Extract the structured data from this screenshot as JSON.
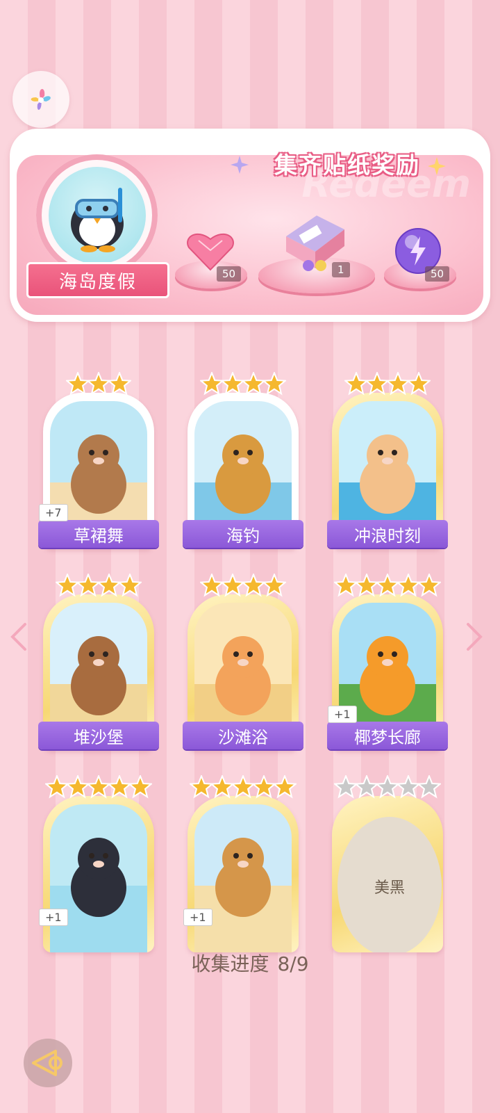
{
  "banner": {
    "title": "集齐贴纸奖励",
    "watermark": "Redeem",
    "album_name": "海岛度假",
    "rewards": [
      {
        "icon": "pink-heart-gem-icon",
        "count": "50"
      },
      {
        "icon": "gift-box-icon",
        "count": "1"
      },
      {
        "icon": "purple-energy-orb-icon",
        "count": "50"
      }
    ]
  },
  "stickers": [
    {
      "name": "草裙舞",
      "stars": 3,
      "duplicate": "+7",
      "collected": true,
      "rarity": "normal",
      "art": "capybara-hula-dancer"
    },
    {
      "name": "海钓",
      "stars": 4,
      "duplicate": "",
      "collected": true,
      "rarity": "normal",
      "art": "lion-fishing-boat"
    },
    {
      "name": "冲浪时刻",
      "stars": 4,
      "duplicate": "",
      "collected": true,
      "rarity": "gold",
      "art": "hamster-surfing"
    },
    {
      "name": "堆沙堡",
      "stars": 4,
      "duplicate": "",
      "collected": true,
      "rarity": "gold",
      "art": "bear-sandcastle"
    },
    {
      "name": "沙滩浴",
      "stars": 4,
      "duplicate": "",
      "collected": true,
      "rarity": "gold",
      "art": "cat-sand-bath"
    },
    {
      "name": "椰梦长廊",
      "stars": 5,
      "duplicate": "+1",
      "collected": true,
      "rarity": "gold",
      "art": "palm-tree-corridor"
    },
    {
      "name": "",
      "stars": 5,
      "duplicate": "+1",
      "collected": true,
      "rarity": "gold",
      "art": "penguin-snorkel"
    },
    {
      "name": "",
      "stars": 5,
      "duplicate": "+1",
      "collected": true,
      "rarity": "gold",
      "art": "beach-hut"
    },
    {
      "name": "美黑",
      "stars": 5,
      "duplicate": "",
      "collected": false,
      "rarity": "gold",
      "art": ""
    }
  ],
  "progress": {
    "label": "收集进度",
    "value": "8/9"
  },
  "colors": {
    "accent_pink": "#e9537a",
    "label_purple": "#8b58d8",
    "star_gold": "#f5b82e",
    "star_silver": "#c9c9c9"
  }
}
